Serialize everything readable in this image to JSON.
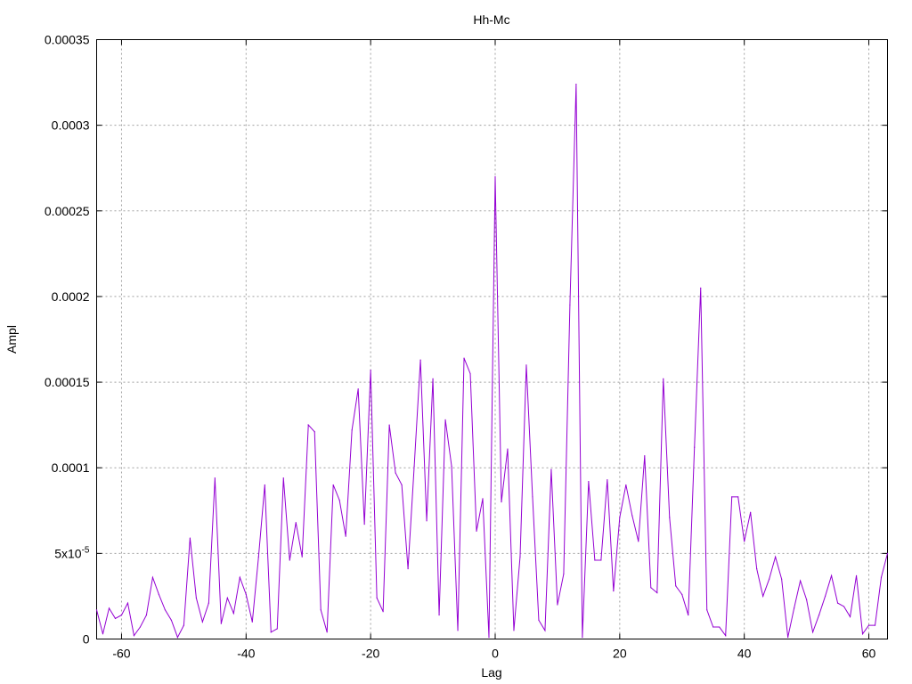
{
  "chart_data": {
    "type": "line",
    "title": "Hh-Mc",
    "xlabel": "Lag",
    "ylabel": "Ampl",
    "xlim": [
      -64,
      63
    ],
    "ylim": [
      0,
      0.00035
    ],
    "grid": true,
    "line_color": "#9400d3",
    "x_ticks": [
      {
        "value": -60,
        "label": "-60"
      },
      {
        "value": -40,
        "label": "-40"
      },
      {
        "value": -20,
        "label": "-20"
      },
      {
        "value": 0,
        "label": "0"
      },
      {
        "value": 20,
        "label": "20"
      },
      {
        "value": 40,
        "label": "40"
      },
      {
        "value": 60,
        "label": "60"
      }
    ],
    "y_ticks": [
      {
        "value": 0,
        "label": "0"
      },
      {
        "value": 5e-05,
        "label": "5x10",
        "sup": "-5"
      },
      {
        "value": 0.0001,
        "label": "0.0001"
      },
      {
        "value": 0.00015,
        "label": "0.00015"
      },
      {
        "value": 0.0002,
        "label": "0.0002"
      },
      {
        "value": 0.00025,
        "label": "0.00025"
      },
      {
        "value": 0.0003,
        "label": "0.0003"
      },
      {
        "value": 0.00035,
        "label": "0.00035"
      }
    ],
    "series": [
      {
        "x": [
          -64,
          -63,
          -62,
          -61,
          -60,
          -59,
          -58,
          -57,
          -56,
          -55,
          -54,
          -53,
          -52,
          -51,
          -50,
          -49,
          -48,
          -47,
          -46,
          -45,
          -44,
          -43,
          -42,
          -41,
          -40,
          -39,
          -38,
          -37,
          -36,
          -35,
          -34,
          -33,
          -32,
          -31,
          -30,
          -29,
          -28,
          -27,
          -26,
          -25,
          -24,
          -23,
          -22,
          -21,
          -20,
          -19,
          -18,
          -17,
          -16,
          -15,
          -14,
          -13,
          -12,
          -11,
          -10,
          -9,
          -8,
          -7,
          -6,
          -5,
          -4,
          -3,
          -2,
          -1,
          0,
          1,
          2,
          3,
          4,
          5,
          6,
          7,
          8,
          9,
          10,
          11,
          12,
          13,
          14,
          15,
          16,
          17,
          18,
          19,
          20,
          21,
          22,
          23,
          24,
          25,
          26,
          27,
          28,
          29,
          30,
          31,
          32,
          33,
          34,
          35,
          36,
          37,
          38,
          39,
          40,
          41,
          42,
          43,
          44,
          45,
          46,
          47,
          48,
          49,
          50,
          51,
          52,
          53,
          54,
          55,
          56,
          57,
          58,
          59,
          60,
          61,
          62,
          63
        ],
        "y": [
          1.7e-05,
          3e-06,
          1.8e-05,
          1.2e-05,
          1.4e-05,
          2.1e-05,
          2e-06,
          7e-06,
          1.4e-05,
          3.6e-05,
          2.6e-05,
          1.7e-05,
          1.1e-05,
          1e-06,
          8e-06,
          5.9e-05,
          2.4e-05,
          1e-05,
          2.1e-05,
          9.4e-05,
          9e-06,
          2.4e-05,
          1.5e-05,
          3.6e-05,
          2.6e-05,
          1e-05,
          4.8e-05,
          9e-05,
          4e-06,
          6e-06,
          9.4e-05,
          4.6e-05,
          6.8e-05,
          4.8e-05,
          0.000125,
          0.000121,
          1.7e-05,
          4e-06,
          9e-05,
          8.1e-05,
          6e-05,
          0.000122,
          0.000146,
          6.7e-05,
          0.000157,
          2.4e-05,
          1.6e-05,
          0.000125,
          9.7e-05,
          9e-05,
          4.1e-05,
          0.000101,
          0.000163,
          6.9e-05,
          0.000152,
          1.4e-05,
          0.000128,
          0.000101,
          5e-06,
          0.000164,
          0.000155,
          6.3e-05,
          8.2e-05,
          1e-06,
          0.00027,
          8e-05,
          0.000111,
          5e-06,
          4.8e-05,
          0.00016,
          8.3e-05,
          1.1e-05,
          5e-06,
          9.9e-05,
          2e-05,
          3.8e-05,
          0.000195,
          0.000324,
          1e-06,
          9.2e-05,
          4.6e-05,
          4.6e-05,
          9.3e-05,
          2.8e-05,
          7.1e-05,
          9e-05,
          7.2e-05,
          5.7e-05,
          0.000107,
          3e-05,
          2.7e-05,
          0.000152,
          7.1e-05,
          3.1e-05,
          2.6e-05,
          1.4e-05,
          0.000112,
          0.000205,
          1.7e-05,
          7e-06,
          7e-06,
          2e-06,
          8.3e-05,
          8.3e-05,
          5.7e-05,
          7.4e-05,
          4.1e-05,
          2.5e-05,
          3.5e-05,
          4.8e-05,
          3.5e-05,
          1e-06,
          1.8e-05,
          3.4e-05,
          2.3e-05,
          4e-06,
          1.4e-05,
          2.5e-05,
          3.7e-05,
          2.1e-05,
          1.9e-05,
          1.3e-05,
          3.7e-05,
          3e-06,
          8e-06,
          8e-06,
          3.6e-05,
          5e-05
        ]
      }
    ]
  }
}
